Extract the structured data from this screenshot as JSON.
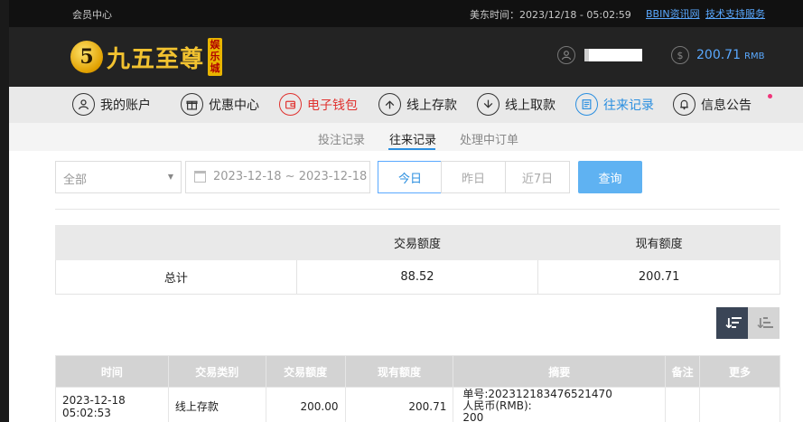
{
  "topbar": {
    "member_center": "会员中心",
    "time_label": "美东时间：2023/12/18 - 05:02:59",
    "link_bbin": "BBIN资讯网",
    "link_support": "技术支持服务"
  },
  "header": {
    "logo_mark": "5",
    "logo_text": "九五至尊",
    "logo_sub": "娱乐城",
    "user_icon": "user-circle-icon",
    "balance_icon": "dollar-circle-icon",
    "balance_value": "200.71",
    "balance_unit": "RMB"
  },
  "nav": {
    "items": [
      {
        "label": "我的账户",
        "icon": "user-icon"
      },
      {
        "label": "优惠中心",
        "icon": "gift-icon"
      },
      {
        "label": "电子钱包",
        "icon": "wallet-icon",
        "color": "#e0322f"
      },
      {
        "label": "线上存款",
        "icon": "deposit-icon"
      },
      {
        "label": "线上取款",
        "icon": "withdraw-icon"
      },
      {
        "label": "往来记录",
        "icon": "record-icon",
        "color": "#2b8fe0"
      },
      {
        "label": "信息公告",
        "icon": "bell-icon"
      }
    ]
  },
  "subnav": {
    "tabs": [
      {
        "label": "投注记录"
      },
      {
        "label": "往来记录",
        "active": true
      },
      {
        "label": "处理中订单"
      }
    ]
  },
  "filters": {
    "type_select": "全部",
    "date_range": "2023-12-18 ~ 2023-12-18",
    "ranges": [
      "今日",
      "昨日",
      "近7日"
    ],
    "query_label": "查询"
  },
  "summary": {
    "headers": [
      "",
      "交易额度",
      "现有额度"
    ],
    "row": {
      "label": "总计",
      "amount": "88.52",
      "balance": "200.71"
    }
  },
  "detail": {
    "headers": [
      "时间",
      "交易类别",
      "交易额度",
      "现有额度",
      "摘要",
      "备注",
      "更多"
    ],
    "rows": [
      {
        "time": "2023-12-18 05:02:53",
        "type": "线上存款",
        "amount": "200.00",
        "balance": "200.71",
        "summary_line1": "单号:202312183476521470",
        "summary_line2": "人民币(RMB):",
        "summary_line3": "200",
        "note": "",
        "more": ""
      }
    ]
  },
  "colors": {
    "accent": "#2b8fe0",
    "wallet": "#e0322f",
    "query_button": "#5fb2f2",
    "header_bg": "#232323",
    "logo_gold": "#f2c230"
  }
}
